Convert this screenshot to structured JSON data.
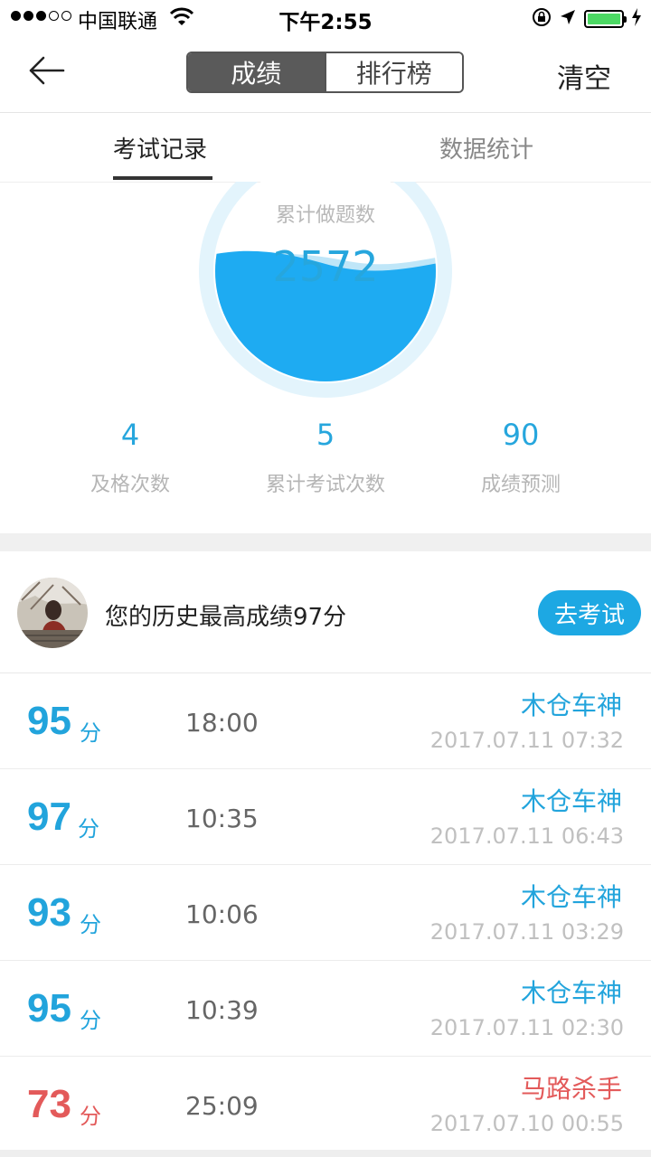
{
  "status_bar": {
    "carrier": "中国联通",
    "time": "下午2:55",
    "signal_bars_filled": 3,
    "signal_bars_total": 5,
    "battery_level": 1.0
  },
  "nav": {
    "segments": [
      "成绩",
      "排行榜"
    ],
    "active_segment": "成绩",
    "clear_label": "清空"
  },
  "tabs": {
    "items": [
      "考试记录",
      "数据统计"
    ],
    "active": "考试记录"
  },
  "summary": {
    "total_label": "累计做题数",
    "total_value": "2572",
    "stats": [
      {
        "value": "4",
        "label": "及格次数"
      },
      {
        "value": "5",
        "label": "累计考试次数"
      },
      {
        "value": "90",
        "label": "成绩预测"
      }
    ]
  },
  "best": {
    "text": "您的历史最高成绩97分",
    "button_label": "去考试"
  },
  "records": [
    {
      "score": "95",
      "unit": "分",
      "duration": "18:00",
      "title": "木仓车神",
      "datetime": "2017.07.11 07:32",
      "color": "#22a4dc"
    },
    {
      "score": "97",
      "unit": "分",
      "duration": "10:35",
      "title": "木仓车神",
      "datetime": "2017.07.11 06:43",
      "color": "#22a4dc"
    },
    {
      "score": "93",
      "unit": "分",
      "duration": "10:06",
      "title": "木仓车神",
      "datetime": "2017.07.11 03:29",
      "color": "#22a4dc"
    },
    {
      "score": "95",
      "unit": "分",
      "duration": "10:39",
      "title": "木仓车神",
      "datetime": "2017.07.11 02:30",
      "color": "#22a4dc"
    },
    {
      "score": "73",
      "unit": "分",
      "duration": "25:09",
      "title": "马路杀手",
      "datetime": "2017.07.10 00:55",
      "color": "#e35a5a"
    }
  ],
  "colors": {
    "accent": "#26a6dd",
    "fail": "#e35a5a"
  },
  "icons": [
    "back-arrow-icon",
    "wifi-icon",
    "rotation-lock-icon",
    "location-arrow-icon",
    "battery-icon",
    "charging-bolt-icon",
    "avatar-photo"
  ]
}
